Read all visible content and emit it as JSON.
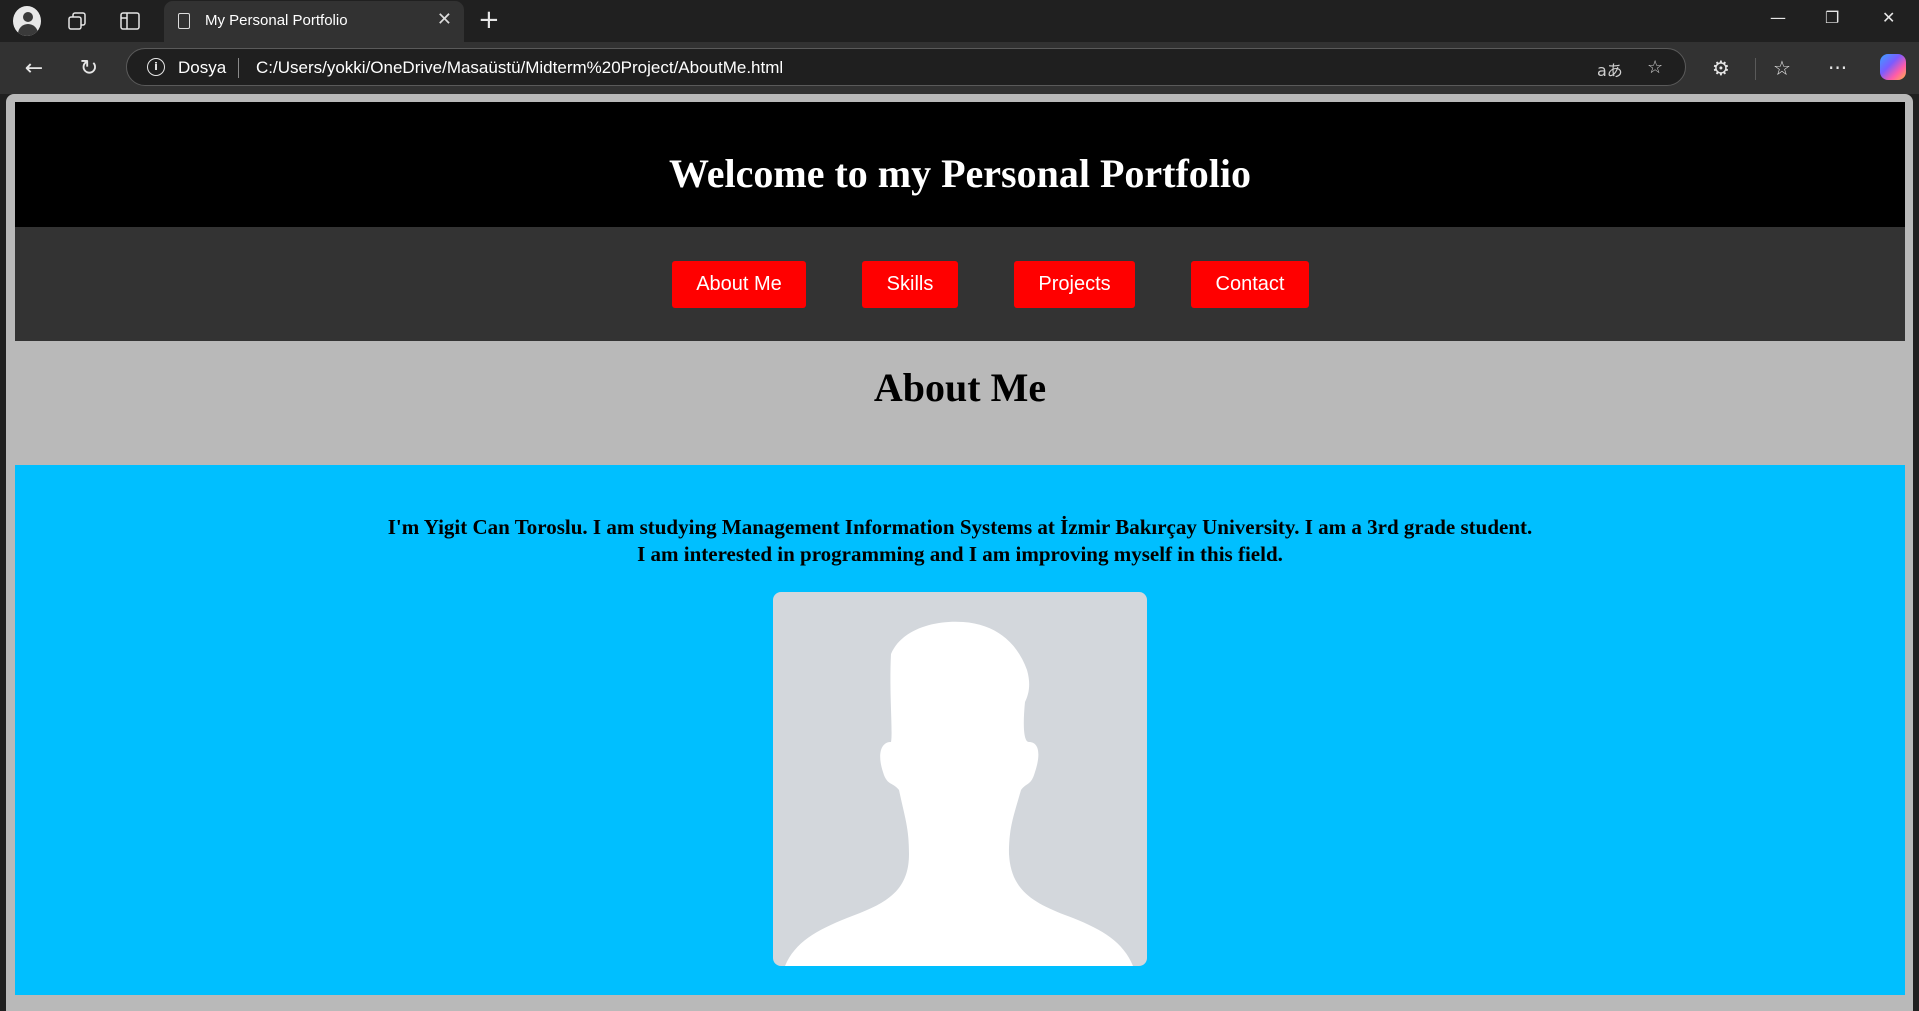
{
  "browser": {
    "tab_title": "My Personal Portfolio",
    "site_info_label": "Dosya",
    "url": "C:/Users/yokki/OneDrive/Masaüstü/Midterm%20Project/AboutMe.html"
  },
  "page": {
    "header_title": "Welcome to my Personal Portfolio",
    "nav": [
      {
        "label": "About Me"
      },
      {
        "label": "Skills"
      },
      {
        "label": "Projects"
      },
      {
        "label": "Contact"
      }
    ],
    "section_title": "About Me",
    "about_line1": "I'm Yigit Can Toroslu. I am studying Management Information Systems at İzmir Bakırçay University. I am a 3rd grade student.",
    "about_line2": "I am interested in programming and I am improving myself in this field.",
    "avatar_icon": "person-silhouette-icon"
  },
  "colors": {
    "header_bg": "#000000",
    "nav_bg": "#333333",
    "nav_button": "#ff0000",
    "page_bg": "#b9b9b9",
    "about_bg": "#00bfff"
  }
}
